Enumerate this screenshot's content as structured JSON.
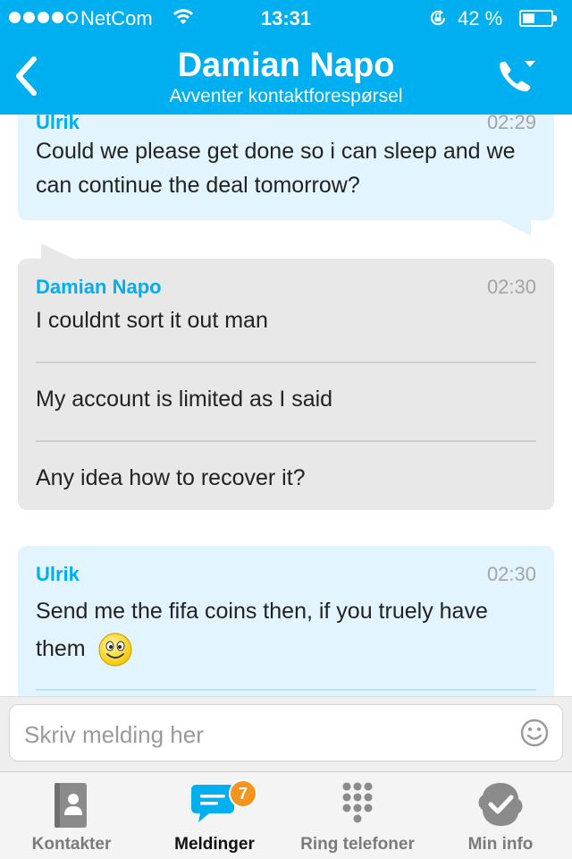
{
  "status_bar": {
    "carrier": "NetCom",
    "time": "13:31",
    "battery_percent": "42 %",
    "battery_level": 0.42
  },
  "nav": {
    "title": "Damian Napo",
    "subtitle": "Avventer kontaktforespørsel"
  },
  "messages": [
    {
      "sender": "Ulrik",
      "time": "02:29",
      "lines": [
        "Could we please get done so i can sleep and we can continue the deal tomorrow?"
      ]
    },
    {
      "sender": "Damian Napo",
      "time": "02:30",
      "lines": [
        "I couldnt sort it out man",
        "My account is limited as I said",
        "Any idea how to recover it?"
      ]
    },
    {
      "sender": "Ulrik",
      "time": "02:30",
      "lines": [
        "Send me the fifa coins then, if you truely have them"
      ]
    }
  ],
  "composer": {
    "placeholder": "Skriv melding her"
  },
  "tabs": [
    {
      "label": "Kontakter",
      "icon": "contacts-icon"
    },
    {
      "label": "Meldinger",
      "icon": "messages-icon",
      "badge": "7"
    },
    {
      "label": "Ring telefoner",
      "icon": "dialpad-icon"
    },
    {
      "label": "Min info",
      "icon": "profile-status-icon"
    }
  ],
  "colors": {
    "accent": "#00aff0",
    "outgoing_bubble": "#e2f4fd",
    "incoming_bubble": "#e8e8e8",
    "badge": "#f7941d"
  }
}
